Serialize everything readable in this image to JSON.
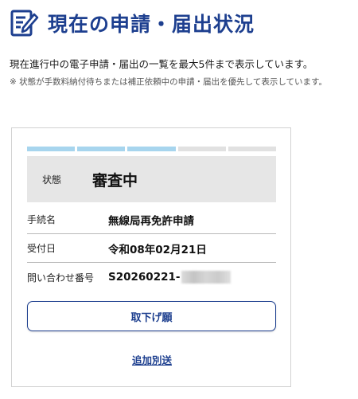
{
  "header": {
    "title": "現在の申請・届出状況",
    "icon": "document-pencil-icon",
    "accent_color": "#1d3f8f"
  },
  "intro": {
    "description": "現在進行中の電子申請・届出の一覧を最大5件まで表示しています。",
    "note": "※ 状態が手数料納付待ちまたは補正依頼中の申請・届出を優先して表示しています。"
  },
  "card": {
    "progress": {
      "total_steps": 5,
      "completed_steps": 3,
      "active_color": "#a7d5ee",
      "inactive_color": "#e1e1e1"
    },
    "status": {
      "label": "状態",
      "value": "審査中"
    },
    "rows": [
      {
        "label": "手続名",
        "value": "無線局再免許申請"
      },
      {
        "label": "受付日",
        "value": "令和08年02月21日"
      },
      {
        "label": "問い合わせ番号",
        "value": "S20260221-"
      }
    ],
    "withdraw_button": "取下げ願",
    "add_link": "追加別送"
  }
}
